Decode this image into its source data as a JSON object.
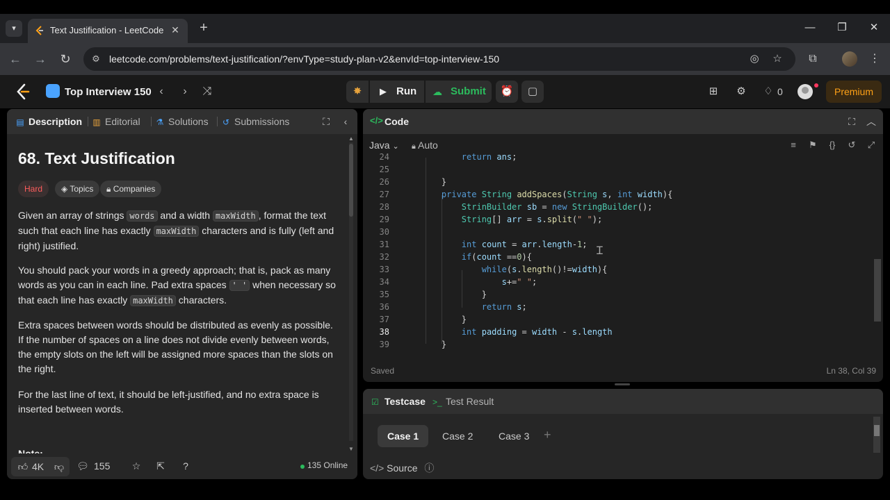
{
  "browser": {
    "tab_title": "Text Justification - LeetCode",
    "url": "leetcode.com/problems/text-justification/?envType=study-plan-v2&envId=top-interview-150",
    "new_tab": "+",
    "tab_close": "✕",
    "minimize": "—",
    "restore": "❐",
    "close": "✕"
  },
  "nav": {
    "study_plan": "Top Interview 150",
    "run_label": "Run",
    "submit_label": "Submit",
    "fire_count": "0",
    "premium_label": "Premium",
    "colors": {
      "accent": "#ffa116",
      "submit": "#2cbb5d"
    }
  },
  "left_tabs": {
    "description": "Description",
    "editorial": "Editorial",
    "solutions": "Solutions",
    "submissions": "Submissions"
  },
  "problem": {
    "title": "68. Text Justification",
    "difficulty": "Hard",
    "topics": "Topics",
    "companies": "Companies",
    "p1_a": "Given an array of strings ",
    "p1_code1": "words",
    "p1_b": " and a width ",
    "p1_code2": "maxWidth",
    "p1_c": ", format the text such that each line has exactly ",
    "p1_code3": "maxWidth",
    "p1_d": " characters and is fully (left and right) justified.",
    "p2_a": "You should pack your words in a greedy approach; that is, pack as many words as you can in each line. Pad extra spaces ",
    "p2_code1": "' '",
    "p2_b": " when necessary so that each line has exactly ",
    "p2_code2": "maxWidth",
    "p2_c": " characters.",
    "p3": "Extra spaces between words should be distributed as evenly as possible. If the number of spaces on a line does not divide evenly between words, the empty slots on the left will be assigned more spaces than the slots on the right.",
    "p4": "For the last line of text, it should be left-justified, and no extra space is inserted between words.",
    "note": "Note:"
  },
  "footer": {
    "likes": "4K",
    "comments": "155",
    "online": "135 Online"
  },
  "code_panel": {
    "title": "Code",
    "language": "Java",
    "mode": "Auto",
    "status_left": "Saved",
    "status_right": "Ln 38, Col 39",
    "current_line": 38
  },
  "code_lines": [
    {
      "n": "24",
      "t": "        return ans;"
    },
    {
      "n": "25",
      "t": ""
    },
    {
      "n": "26",
      "t": "    }"
    },
    {
      "n": "27",
      "t": "    private String addSpaces(String s, int width){"
    },
    {
      "n": "28",
      "t": "        StrinBuilder sb = new StringBuilder();"
    },
    {
      "n": "29",
      "t": "        String[] arr = s.split(\" \");"
    },
    {
      "n": "30",
      "t": ""
    },
    {
      "n": "31",
      "t": "        int count = arr.length-1;"
    },
    {
      "n": "32",
      "t": "        if(count ==0){"
    },
    {
      "n": "33",
      "t": "            while(s.length()!=width){"
    },
    {
      "n": "34",
      "t": "                s+=\" \";"
    },
    {
      "n": "35",
      "t": "            }"
    },
    {
      "n": "36",
      "t": "            return s;"
    },
    {
      "n": "37",
      "t": "        }"
    },
    {
      "n": "38",
      "t": "        int padding = width - s.length"
    },
    {
      "n": "39",
      "t": "    }"
    }
  ],
  "test_panel": {
    "testcase_tab": "Testcase",
    "result_tab": "Test Result",
    "cases": [
      "Case 1",
      "Case 2",
      "Case 3"
    ],
    "add": "+",
    "source": "Source"
  }
}
